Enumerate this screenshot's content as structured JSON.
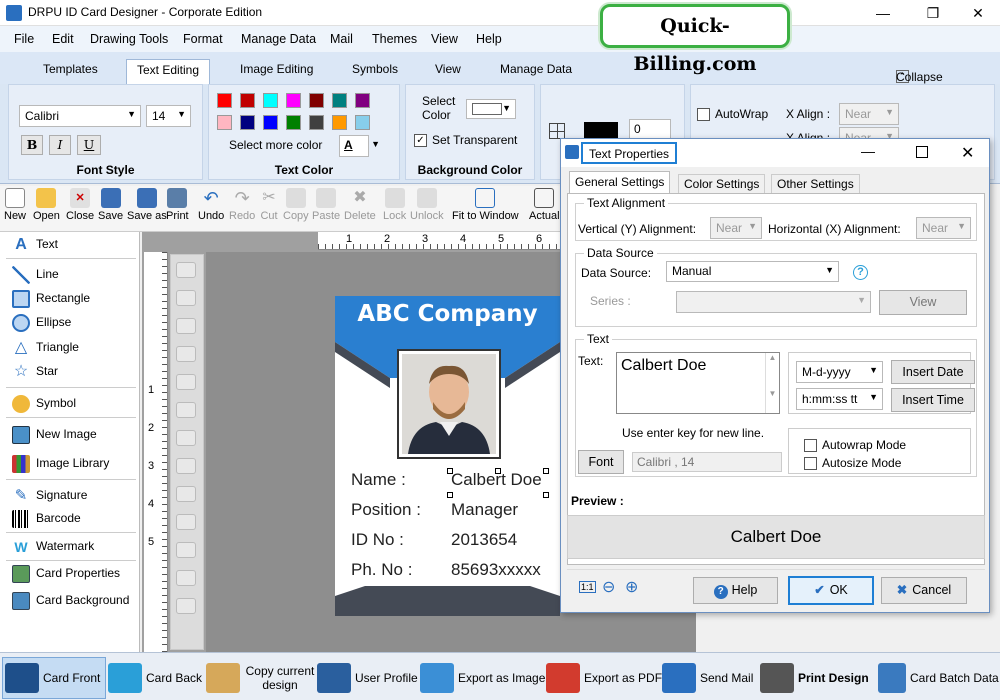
{
  "app_title": "DRPU ID Card Designer - Corporate Edition",
  "logo_text": "Quick-Billing.com",
  "menu": [
    "File",
    "Edit",
    "Drawing Tools",
    "Format",
    "Manage Data",
    "Mail",
    "Themes",
    "View",
    "Help"
  ],
  "ribbon_tabs": [
    "Templates",
    "Text Editing",
    "Image Editing",
    "Symbols",
    "View",
    "Manage Data"
  ],
  "collapse_label": "Collapse",
  "font_style": {
    "font": "Calibri",
    "size": "14",
    "bold": "B",
    "italic": "I",
    "underline": "U",
    "label": "Font Style"
  },
  "text_color": {
    "more": "Select more color",
    "a_glyph": "A",
    "label": "Text Color",
    "swatches": [
      "#ff0000",
      "#c00000",
      "#00ffff",
      "#ff00ff",
      "#800000",
      "#008080",
      "#800080",
      "#ffb6c1",
      "#000080",
      "#0000ff",
      "#008000",
      "#404040",
      "#ff9900",
      "#87ceeb"
    ]
  },
  "bg_color": {
    "select": "Select",
    "color": "Color",
    "transparent": "Set Transparent",
    "label": "Background Color"
  },
  "ribbon_right": {
    "autowrap": "AutoWrap",
    "xalign1": "X Align :",
    "near1": "Near",
    "xalign2": "X Align :",
    "near2": "Near",
    "num": "0"
  },
  "toolbar": [
    "New",
    "Open",
    "Close",
    "Save",
    "Save as",
    "Print",
    "Undo",
    "Redo",
    "Cut",
    "Copy",
    "Paste",
    "Delete",
    "Lock",
    "Unlock",
    "Fit to Window",
    "Actual"
  ],
  "left_panel": [
    "Text",
    "Line",
    "Rectangle",
    "Ellipse",
    "Triangle",
    "Star",
    "Symbol",
    "New Image",
    "Image Library",
    "Signature",
    "Barcode",
    "Watermark",
    "Card Properties",
    "Card Background"
  ],
  "ruler_top": [
    "1",
    "2",
    "3",
    "4",
    "5",
    "6"
  ],
  "ruler_left": [
    "1",
    "2",
    "3",
    "4",
    "5"
  ],
  "card": {
    "company": "ABC Company",
    "rows": [
      {
        "label": "Name :",
        "value": "Calbert Doe"
      },
      {
        "label": "Position :",
        "value": "Manager"
      },
      {
        "label": "ID No :",
        "value": "2013654"
      },
      {
        "label": "Ph. No :",
        "value": "85693xxxxx"
      }
    ]
  },
  "dialog": {
    "title": "Text Properties",
    "tabs": [
      "General Settings",
      "Color Settings",
      "Other Settings"
    ],
    "text_alignment": "Text Alignment",
    "vertical_label": "Vertical (Y) Alignment:",
    "vertical_value": "Near",
    "horizontal_label": "Horizontal (X) Alignment:",
    "horizontal_value": "Near",
    "data_source_group": "Data Source",
    "data_source_label": "Data Source:",
    "data_source_value": "Manual",
    "help_glyph": "?",
    "series_label": "Series :",
    "view_button": "View",
    "text_group": "Text",
    "text_label": "Text:",
    "text_value": "Calbert Doe",
    "date_format": "M-d-yyyy",
    "time_format": "h:mm:ss tt",
    "insert_date": "Insert Date",
    "insert_time": "Insert Time",
    "enter_hint": "Use enter key for new line.",
    "font_button": "Font",
    "font_value": "Calibri , 14",
    "autowrap": "Autowrap Mode",
    "autosize": "Autosize Mode",
    "preview_label": "Preview :",
    "preview_text": "Calbert Doe",
    "zoom_actual": "1:1",
    "help_button": "Help",
    "ok_button": "OK",
    "cancel_button": "Cancel"
  },
  "bottom_bar": [
    "Card Front",
    "Card Back",
    "Copy current design",
    "User Profile",
    "Export as Image",
    "Export as PDF",
    "Send Mail",
    "Print Design",
    "Card Batch Data"
  ],
  "colors": {
    "accent": "#1f7fd4",
    "card_header": "#2a7fd0",
    "card_dark": "#444a55",
    "brand_green": "#3cb043"
  }
}
